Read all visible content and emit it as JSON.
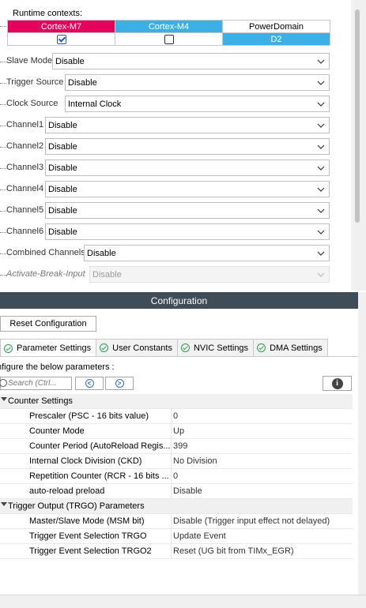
{
  "runtime": {
    "label": "Runtime contexts:",
    "headers": [
      "Cortex-M7",
      "Cortex-M4",
      "PowerDomain"
    ],
    "m7_checked": true,
    "m4_checked": false,
    "power_domain": "D2",
    "colors": {
      "m7": "#e5005b",
      "m4": "#3cb0e6",
      "d2": "#3cb0e6"
    }
  },
  "mode_params": [
    {
      "label": "Slave Mode",
      "value": "Disable"
    },
    {
      "label": "Trigger Source",
      "value": "Disable"
    },
    {
      "label": "Clock Source",
      "value": "Internal Clock"
    },
    {
      "label": "Channel1",
      "value": "Disable"
    },
    {
      "label": "Channel2",
      "value": "Disable"
    },
    {
      "label": "Channel3",
      "value": "Disable"
    },
    {
      "label": "Channel4",
      "value": "Disable"
    },
    {
      "label": "Channel5",
      "value": "Disable"
    },
    {
      "label": "Channel6",
      "value": "Disable"
    },
    {
      "label": "Combined Channels",
      "value": "Disable"
    },
    {
      "label": "Activate-Break-Input",
      "value": "Disable",
      "disabled": true
    }
  ],
  "config": {
    "title": "Configuration",
    "reset_button": "Reset Configuration",
    "tabs": [
      {
        "label": "Parameter Settings",
        "active": true
      },
      {
        "label": "User Constants",
        "active": false
      },
      {
        "label": "NVIC Settings",
        "active": false
      },
      {
        "label": "DMA Settings",
        "active": false
      }
    ],
    "instruction": "nfigure the below parameters :",
    "search_placeholder": "Search (Ctrl...",
    "groups": [
      {
        "name": "Counter Settings",
        "rows": [
          {
            "name": "Prescaler (PSC - 16 bits value)",
            "value": "0"
          },
          {
            "name": "Counter Mode",
            "value": "Up"
          },
          {
            "name": "Counter Period (AutoReload Regis...",
            "value": "399"
          },
          {
            "name": "Internal Clock Division (CKD)",
            "value": "No Division"
          },
          {
            "name": "Repetition Counter (RCR - 16 bits ...",
            "value": "0"
          },
          {
            "name": "auto-reload preload",
            "value": "Disable"
          }
        ]
      },
      {
        "name": "Trigger Output (TRGO) Parameters",
        "rows": [
          {
            "name": "Master/Slave Mode (MSM bit)",
            "value": "Disable (Trigger input effect not delayed)"
          },
          {
            "name": "Trigger Event Selection TRGO",
            "value": "Update Event"
          },
          {
            "name": "Trigger Event Selection TRGO2",
            "value": "Reset (UG bit from TIMx_EGR)"
          }
        ]
      }
    ]
  }
}
